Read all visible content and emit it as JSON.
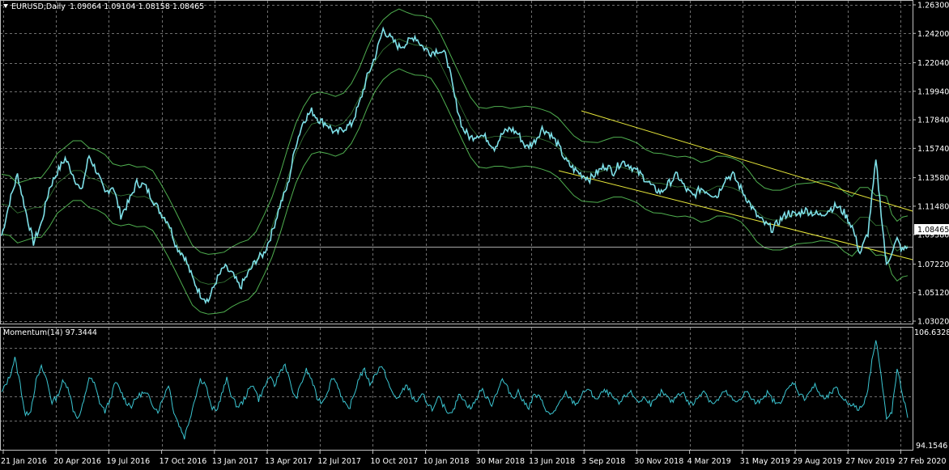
{
  "colors": {
    "background": "#000000",
    "grid": "#6f6f6f",
    "frame": "#bfbfbf",
    "text": "#ffffff",
    "price_line": "#7ee0e8",
    "band": "#4fae4f",
    "channel": "#e8e83a",
    "bid_line": "#a8a8a8",
    "momentum": "#3bc6d2"
  },
  "main_header": {
    "icon": "triangle-down-icon",
    "symbol": "EURUSD,Daily",
    "ohlc": "1.09064 1.09104 1.08158 1.08465"
  },
  "indicator_header": "Momentum(14) 97.3444",
  "current_price_label": "1.08465",
  "chart_data": [
    {
      "type": "line",
      "name": "price",
      "x_labels": [
        "21 Jan 2016",
        "20 Apr 2016",
        "19 Jul 2016",
        "17 Oct 2016",
        "13 Jan 2017",
        "13 Apr 2017",
        "12 Jul 2017",
        "10 Oct 2017",
        "10 Jan 2018",
        "30 Mar 2018",
        "13 Jun 2018",
        "3 Sep 2018",
        "30 Nov 2018",
        "4 Mar 2019",
        "31 May 2019",
        "29 Aug 2019",
        "27 Nov 2019",
        "27 Feb 2020"
      ],
      "y_ticks": [
        "1.26300",
        "1.24200",
        "1.22040",
        "1.19940",
        "1.17840",
        "1.15740",
        "1.13580",
        "1.11480",
        "1.09380",
        "1.07220",
        "1.05120",
        "1.03020"
      ],
      "ylim": [
        1.0302,
        1.263
      ],
      "current_price": 1.08465,
      "grid": true,
      "points": [
        [
          0,
          1.093
        ],
        [
          3,
          1.118
        ],
        [
          6,
          1.138
        ],
        [
          9,
          1.112
        ],
        [
          12,
          1.088
        ],
        [
          15,
          1.102
        ],
        [
          18,
          1.128
        ],
        [
          21,
          1.14
        ],
        [
          24,
          1.15
        ],
        [
          27,
          1.138
        ],
        [
          30,
          1.125
        ],
        [
          33,
          1.152
        ],
        [
          36,
          1.14
        ],
        [
          39,
          1.124
        ],
        [
          42,
          1.13
        ],
        [
          45,
          1.108
        ],
        [
          48,
          1.118
        ],
        [
          51,
          1.132
        ],
        [
          54,
          1.13
        ],
        [
          57,
          1.12
        ],
        [
          60,
          1.11
        ],
        [
          63,
          1.103
        ],
        [
          66,
          1.085
        ],
        [
          69,
          1.078
        ],
        [
          72,
          1.062
        ],
        [
          75,
          1.05
        ],
        [
          78,
          1.045
        ],
        [
          81,
          1.06
        ],
        [
          84,
          1.07
        ],
        [
          87,
          1.065
        ],
        [
          90,
          1.055
        ],
        [
          93,
          1.065
        ],
        [
          96,
          1.075
        ],
        [
          99,
          1.08
        ],
        [
          102,
          1.095
        ],
        [
          105,
          1.115
        ],
        [
          108,
          1.13
        ],
        [
          111,
          1.16
        ],
        [
          114,
          1.178
        ],
        [
          117,
          1.185
        ],
        [
          120,
          1.178
        ],
        [
          123,
          1.175
        ],
        [
          126,
          1.168
        ],
        [
          129,
          1.172
        ],
        [
          132,
          1.175
        ],
        [
          135,
          1.19
        ],
        [
          138,
          1.21
        ],
        [
          141,
          1.225
        ],
        [
          144,
          1.245
        ],
        [
          147,
          1.238
        ],
        [
          150,
          1.232
        ],
        [
          153,
          1.235
        ],
        [
          156,
          1.24
        ],
        [
          159,
          1.232
        ],
        [
          162,
          1.228
        ],
        [
          165,
          1.23
        ],
        [
          168,
          1.225
        ],
        [
          171,
          1.195
        ],
        [
          174,
          1.172
        ],
        [
          177,
          1.165
        ],
        [
          180,
          1.168
        ],
        [
          183,
          1.165
        ],
        [
          186,
          1.158
        ],
        [
          189,
          1.168
        ],
        [
          192,
          1.172
        ],
        [
          195,
          1.168
        ],
        [
          198,
          1.158
        ],
        [
          201,
          1.162
        ],
        [
          204,
          1.172
        ],
        [
          207,
          1.168
        ],
        [
          210,
          1.16
        ],
        [
          213,
          1.148
        ],
        [
          216,
          1.142
        ],
        [
          219,
          1.138
        ],
        [
          222,
          1.135
        ],
        [
          225,
          1.14
        ],
        [
          228,
          1.145
        ],
        [
          231,
          1.14
        ],
        [
          234,
          1.148
        ],
        [
          237,
          1.145
        ],
        [
          240,
          1.14
        ],
        [
          243,
          1.135
        ],
        [
          246,
          1.128
        ],
        [
          249,
          1.125
        ],
        [
          252,
          1.132
        ],
        [
          255,
          1.138
        ],
        [
          258,
          1.128
        ],
        [
          261,
          1.122
        ],
        [
          264,
          1.128
        ],
        [
          267,
          1.125
        ],
        [
          270,
          1.122
        ],
        [
          273,
          1.135
        ],
        [
          276,
          1.138
        ],
        [
          279,
          1.128
        ],
        [
          282,
          1.118
        ],
        [
          285,
          1.108
        ],
        [
          288,
          1.102
        ],
        [
          291,
          1.098
        ],
        [
          294,
          1.105
        ],
        [
          297,
          1.11
        ],
        [
          300,
          1.108
        ],
        [
          303,
          1.112
        ],
        [
          306,
          1.11
        ],
        [
          309,
          1.108
        ],
        [
          312,
          1.112
        ],
        [
          315,
          1.115
        ],
        [
          318,
          1.11
        ],
        [
          321,
          1.1
        ],
        [
          324,
          1.08
        ],
        [
          327,
          1.095
        ],
        [
          330,
          1.148
        ],
        [
          332,
          1.11
        ],
        [
          334,
          1.07
        ],
        [
          336,
          1.082
        ],
        [
          338,
          1.09
        ],
        [
          340,
          1.082
        ],
        [
          342,
          1.085
        ]
      ]
    },
    {
      "type": "line",
      "name": "Momentum(14)",
      "value": 97.3444,
      "y_ticks": [
        "106.6328",
        "94.1546"
      ],
      "ylim": [
        94.1546,
        106.6328
      ],
      "points": [
        [
          0,
          100.0
        ],
        [
          3,
          101.8
        ],
        [
          5,
          103.8
        ],
        [
          7,
          101.0
        ],
        [
          9,
          97.5
        ],
        [
          11,
          98.2
        ],
        [
          13,
          101.3
        ],
        [
          15,
          102.8
        ],
        [
          17,
          101.5
        ],
        [
          19,
          99.0
        ],
        [
          21,
          99.6
        ],
        [
          23,
          101.2
        ],
        [
          25,
          100.8
        ],
        [
          27,
          98.2
        ],
        [
          29,
          97.2
        ],
        [
          31,
          99.0
        ],
        [
          33,
          101.8
        ],
        [
          35,
          101.0
        ],
        [
          37,
          99.0
        ],
        [
          39,
          98.0
        ],
        [
          41,
          99.3
        ],
        [
          43,
          101.2
        ],
        [
          45,
          100.2
        ],
        [
          47,
          99.0
        ],
        [
          49,
          98.6
        ],
        [
          51,
          99.5
        ],
        [
          53,
          100.0
        ],
        [
          55,
          99.8
        ],
        [
          57,
          98.8
        ],
        [
          59,
          98.0
        ],
        [
          61,
          99.5
        ],
        [
          63,
          101.0
        ],
        [
          65,
          98.0
        ],
        [
          67,
          96.5
        ],
        [
          69,
          95.2
        ],
        [
          71,
          97.2
        ],
        [
          73,
          99.5
        ],
        [
          75,
          101.5
        ],
        [
          77,
          101.0
        ],
        [
          79,
          98.5
        ],
        [
          81,
          98.0
        ],
        [
          83,
          99.8
        ],
        [
          85,
          101.5
        ],
        [
          87,
          99.5
        ],
        [
          89,
          98.5
        ],
        [
          91,
          99.0
        ],
        [
          93,
          100.2
        ],
        [
          95,
          101.0
        ],
        [
          97,
          99.3
        ],
        [
          99,
          100.5
        ],
        [
          101,
          101.8
        ],
        [
          103,
          100.8
        ],
        [
          105,
          102.3
        ],
        [
          107,
          103.2
        ],
        [
          109,
          101.0
        ],
        [
          111,
          99.3
        ],
        [
          113,
          101.0
        ],
        [
          115,
          102.5
        ],
        [
          117,
          101.5
        ],
        [
          119,
          99.5
        ],
        [
          121,
          99.0
        ],
        [
          123,
          100.2
        ],
        [
          125,
          101.8
        ],
        [
          127,
          100.8
        ],
        [
          129,
          99.0
        ],
        [
          131,
          98.2
        ],
        [
          133,
          99.8
        ],
        [
          135,
          101.8
        ],
        [
          137,
          102.5
        ],
        [
          139,
          101.0
        ],
        [
          141,
          102.0
        ],
        [
          143,
          103.0
        ],
        [
          145,
          102.0
        ],
        [
          147,
          100.2
        ],
        [
          149,
          99.4
        ],
        [
          151,
          100.0
        ],
        [
          153,
          101.0
        ],
        [
          155,
          99.5
        ],
        [
          157,
          99.0
        ],
        [
          159,
          99.8
        ],
        [
          161,
          98.8
        ],
        [
          163,
          98.2
        ],
        [
          165,
          99.5
        ],
        [
          167,
          98.5
        ],
        [
          169,
          97.8
        ],
        [
          171,
          98.5
        ],
        [
          173,
          100.0
        ],
        [
          175,
          99.0
        ],
        [
          177,
          98.3
        ],
        [
          179,
          99.2
        ],
        [
          181,
          100.5
        ],
        [
          183,
          99.5
        ],
        [
          185,
          98.8
        ],
        [
          187,
          100.2
        ],
        [
          189,
          101.5
        ],
        [
          191,
          100.5
        ],
        [
          193,
          99.5
        ],
        [
          195,
          100.2
        ],
        [
          197,
          99.0
        ],
        [
          199,
          98.5
        ],
        [
          201,
          99.8
        ],
        [
          203,
          99.5
        ],
        [
          205,
          98.5
        ],
        [
          207,
          97.5
        ],
        [
          209,
          98.2
        ],
        [
          211,
          99.0
        ],
        [
          213,
          100.0
        ],
        [
          215,
          99.2
        ],
        [
          217,
          98.8
        ],
        [
          219,
          99.8
        ],
        [
          221,
          100.5
        ],
        [
          223,
          99.8
        ],
        [
          225,
          99.3
        ],
        [
          227,
          100.2
        ],
        [
          229,
          100.0
        ],
        [
          231,
          99.4
        ],
        [
          233,
          98.8
        ],
        [
          235,
          99.5
        ],
        [
          237,
          100.2
        ],
        [
          239,
          99.5
        ],
        [
          241,
          99.0
        ],
        [
          243,
          99.6
        ],
        [
          245,
          98.8
        ],
        [
          247,
          99.2
        ],
        [
          249,
          100.1
        ],
        [
          251,
          99.6
        ],
        [
          253,
          99.0
        ],
        [
          255,
          99.8
        ],
        [
          257,
          100.2
        ],
        [
          259,
          99.0
        ],
        [
          261,
          98.8
        ],
        [
          263,
          99.6
        ],
        [
          265,
          100.4
        ],
        [
          267,
          99.3
        ],
        [
          269,
          98.8
        ],
        [
          271,
          99.5
        ],
        [
          273,
          100.2
        ],
        [
          275,
          99.6
        ],
        [
          277,
          98.9
        ],
        [
          279,
          99.5
        ],
        [
          281,
          100.2
        ],
        [
          283,
          99.4
        ],
        [
          285,
          98.8
        ],
        [
          287,
          99.5
        ],
        [
          289,
          100.0
        ],
        [
          291,
          99.3
        ],
        [
          293,
          98.7
        ],
        [
          295,
          99.6
        ],
        [
          297,
          100.5
        ],
        [
          299,
          101.2
        ],
        [
          301,
          100.0
        ],
        [
          303,
          99.4
        ],
        [
          305,
          100.2
        ],
        [
          307,
          100.8
        ],
        [
          309,
          99.8
        ],
        [
          311,
          99.3
        ],
        [
          313,
          100.0
        ],
        [
          315,
          100.5
        ],
        [
          317,
          99.6
        ],
        [
          319,
          99.0
        ],
        [
          321,
          98.8
        ],
        [
          323,
          98.2
        ],
        [
          325,
          98.6
        ],
        [
          327,
          100.5
        ],
        [
          329,
          104.5
        ],
        [
          330,
          106.0
        ],
        [
          331,
          104.0
        ],
        [
          333,
          99.5
        ],
        [
          334,
          97.0
        ],
        [
          336,
          98.0
        ],
        [
          338,
          102.5
        ],
        [
          340,
          100.0
        ],
        [
          342,
          97.3
        ]
      ]
    }
  ]
}
